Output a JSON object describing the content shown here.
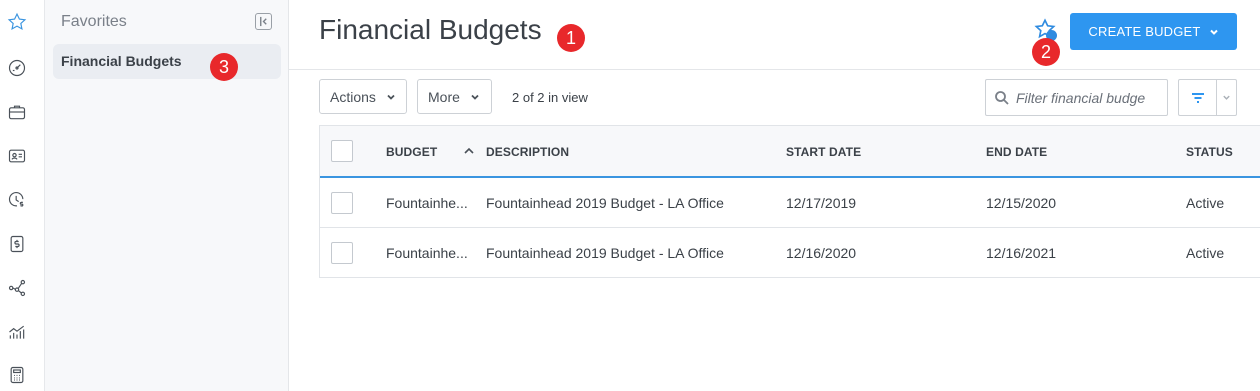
{
  "favorites": {
    "title": "Favorites",
    "items": [
      {
        "label": "Financial Budgets"
      }
    ]
  },
  "header": {
    "title": "Financial Budgets",
    "create_button": "CREATE BUDGET"
  },
  "badges": [
    "1",
    "2",
    "3"
  ],
  "toolbar": {
    "actions_label": "Actions",
    "more_label": "More",
    "view_count": "2 of 2 in view",
    "filter_placeholder": "Filter financial budge"
  },
  "table": {
    "columns": [
      "BUDGET",
      "DESCRIPTION",
      "START DATE",
      "END DATE",
      "STATUS"
    ],
    "rows": [
      {
        "budget": "Fountainhe...",
        "description": "Fountainhead 2019 Budget - LA Office",
        "start_date": "12/17/2019",
        "end_date": "12/15/2020",
        "status": "Active"
      },
      {
        "budget": "Fountainhe...",
        "description": "Fountainhead 2019 Budget - LA Office",
        "start_date": "12/16/2020",
        "end_date": "12/16/2021",
        "status": "Active"
      }
    ]
  },
  "colors": {
    "accent": "#2e96f0",
    "badge": "#e8282b",
    "text": "#3b4148"
  },
  "rail_icons": [
    "star-icon",
    "dashboard-icon",
    "briefcase-icon",
    "contact-card-icon",
    "clock-dollar-icon",
    "money-icon",
    "network-icon",
    "chart-icon",
    "calculator-icon"
  ]
}
